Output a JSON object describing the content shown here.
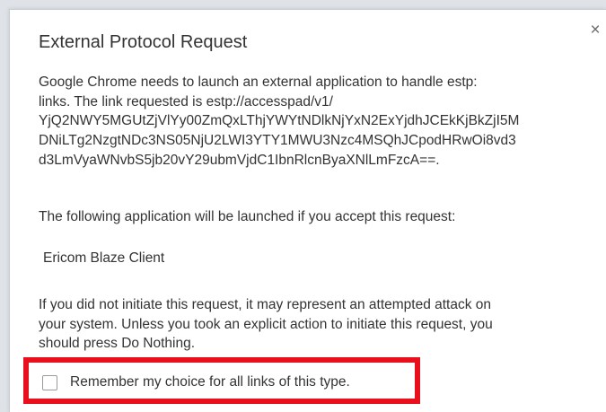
{
  "dialog": {
    "title": "External Protocol Request",
    "close_label": "×",
    "message_lines": [
      "Google Chrome needs to launch an external application to handle estp:",
      "links. The link requested is estp://accesspad/v1/",
      "YjQ2NWY5MGUtZjVlYy00ZmQxLThjYWYtNDlkNjYxN2ExYjdhJCEkKjBkZjI5M",
      "DNiLTg2NzgtNDc3NS05NjU2LWI3YTY1MWU3Nzc4MSQhJCpodHRwOi8vd3",
      "d3LmVyaWNvbS5jb20vY29ubmVjdC1IbnRlcnByaXNlLmFzcA==."
    ],
    "prompt": "The following application will be launched if you accept this request:",
    "application_name": "Ericom Blaze Client",
    "warning_lines": [
      "If you did not initiate this request, it may represent an attempted attack on",
      "your system. Unless you took an explicit action to initiate this request, you",
      "should press Do Nothing."
    ],
    "remember_choice_label": "Remember my choice for all links of this type.",
    "remember_choice_checked": false
  },
  "colors": {
    "highlight": "#e8101d",
    "text": "#333333"
  },
  "icons": {
    "close": "close-icon"
  }
}
